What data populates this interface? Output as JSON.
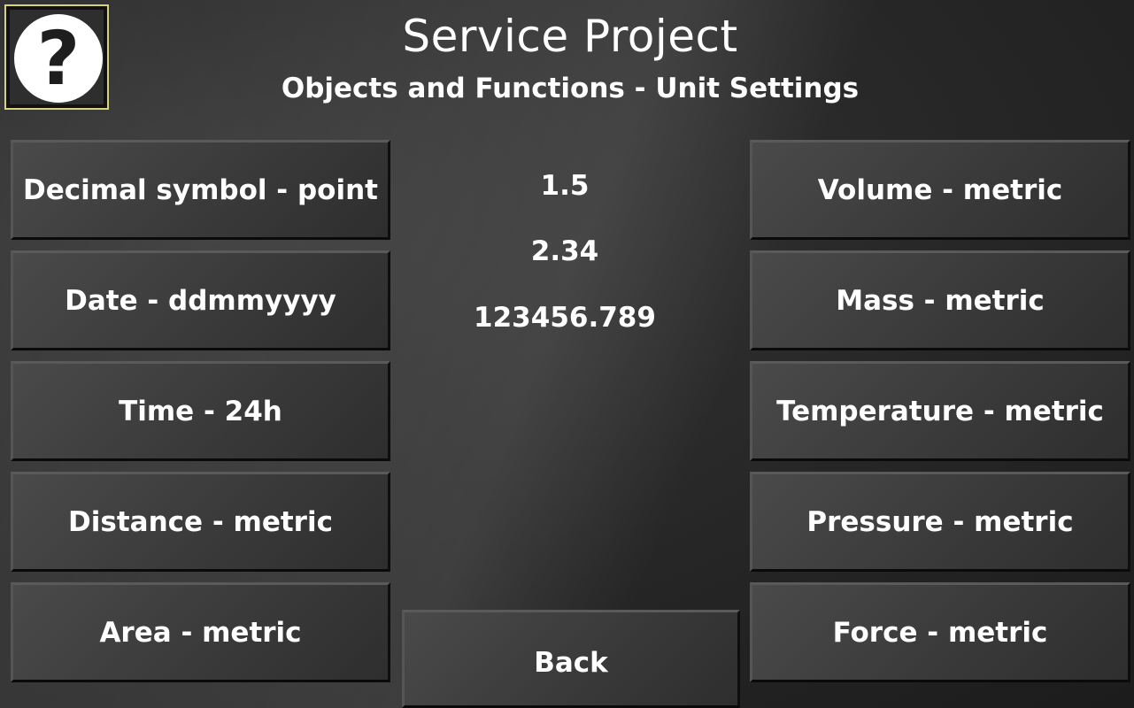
{
  "header": {
    "title": "Service Project",
    "subtitle": "Objects and Functions - Unit Settings",
    "help_glyph": "?"
  },
  "left_buttons": [
    {
      "label": "Decimal symbol - point"
    },
    {
      "label": "Date - ddmmyyyy"
    },
    {
      "label": "Time - 24h"
    },
    {
      "label": "Distance - metric"
    },
    {
      "label": "Area - metric"
    }
  ],
  "right_buttons": [
    {
      "label": "Volume - metric"
    },
    {
      "label": "Mass - metric"
    },
    {
      "label": "Temperature - metric"
    },
    {
      "label": "Pressure - metric"
    },
    {
      "label": "Force - metric"
    }
  ],
  "values": [
    "1.5",
    "2.34",
    "123456.789"
  ],
  "back_label": "Back",
  "colors": {
    "help_border": "#d8d27a",
    "text": "#ffffff"
  }
}
